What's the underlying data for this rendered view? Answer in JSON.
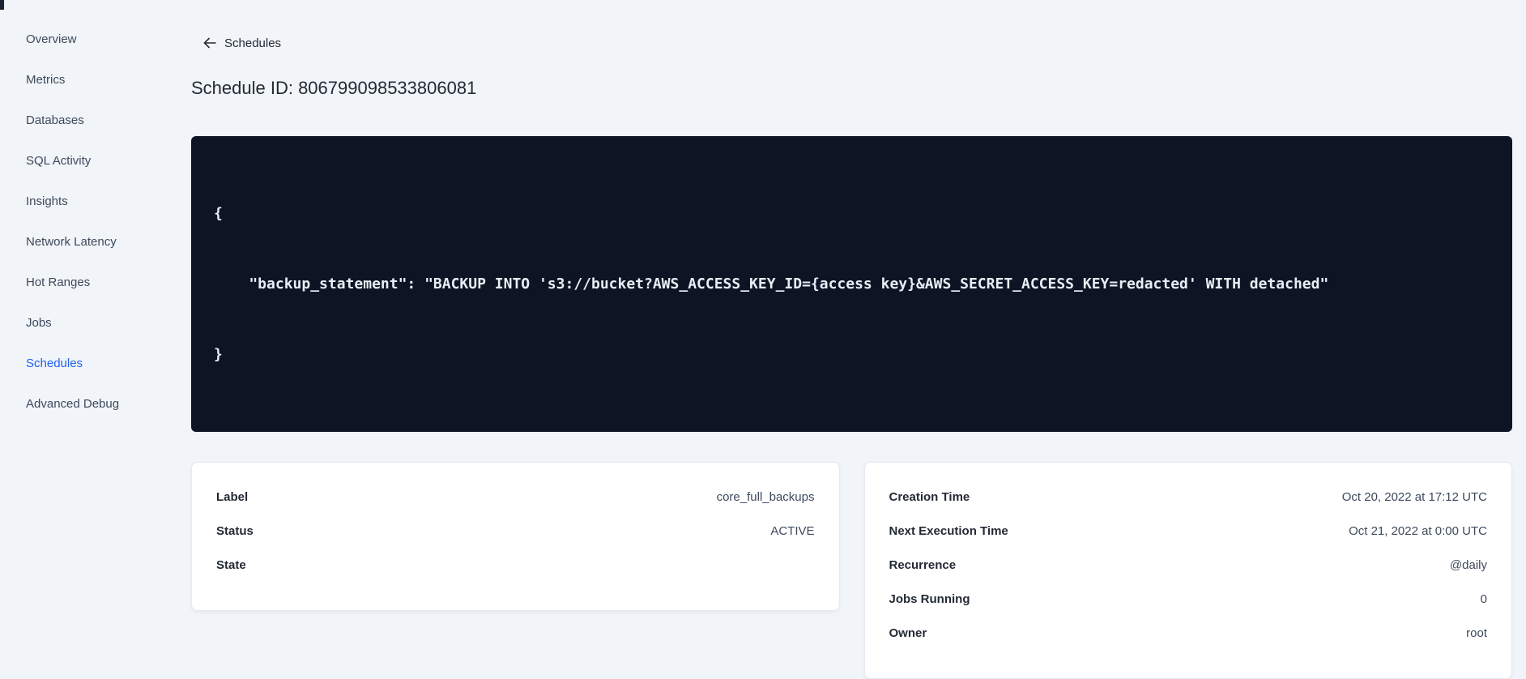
{
  "colors": {
    "page_background": "#f1f4f8",
    "accent_blue": "#2161f0",
    "code_background": "#0d1525",
    "code_text": "#e9eef5",
    "card_background": "#ffffff",
    "heading_text": "#242a35",
    "body_text": "#3d4a5c"
  },
  "sidebar": {
    "items": [
      {
        "label": "Overview",
        "active": false
      },
      {
        "label": "Metrics",
        "active": false
      },
      {
        "label": "Databases",
        "active": false
      },
      {
        "label": "SQL Activity",
        "active": false
      },
      {
        "label": "Insights",
        "active": false
      },
      {
        "label": "Network Latency",
        "active": false
      },
      {
        "label": "Hot Ranges",
        "active": false
      },
      {
        "label": "Jobs",
        "active": false
      },
      {
        "label": "Schedules",
        "active": true
      },
      {
        "label": "Advanced Debug",
        "active": false
      }
    ]
  },
  "header": {
    "back_label": "Schedules",
    "title": "Schedule ID: 806799098533806081"
  },
  "code": {
    "lines": [
      "{",
      "    \"backup_statement\": \"BACKUP INTO 's3://bucket?AWS_ACCESS_KEY_ID={access key}&AWS_SECRET_ACCESS_KEY=redacted' WITH detached\"",
      "}"
    ]
  },
  "details_left": {
    "rows": [
      {
        "label": "Label",
        "value": "core_full_backups"
      },
      {
        "label": "Status",
        "value": "ACTIVE"
      },
      {
        "label": "State",
        "value": ""
      }
    ]
  },
  "details_right": {
    "rows": [
      {
        "label": "Creation Time",
        "value": "Oct 20, 2022 at 17:12 UTC"
      },
      {
        "label": "Next Execution Time",
        "value": "Oct 21, 2022 at 0:00 UTC"
      },
      {
        "label": "Recurrence",
        "value": "@daily"
      },
      {
        "label": "Jobs Running",
        "value": "0"
      },
      {
        "label": "Owner",
        "value": "root"
      }
    ]
  }
}
